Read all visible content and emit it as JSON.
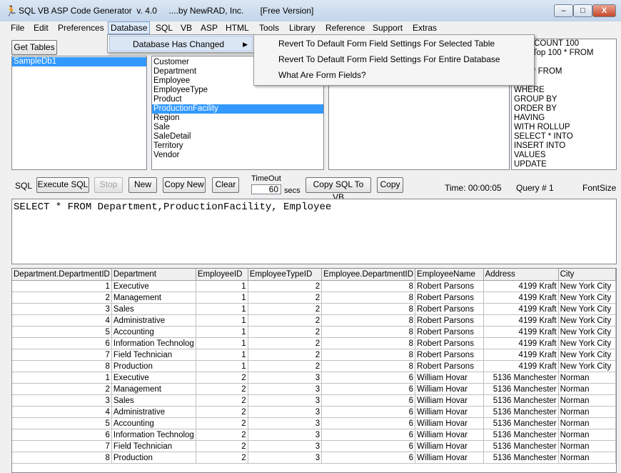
{
  "window": {
    "title": "SQL VB ASP Code Generator  v. 4.0     ....by NewRAD, Inc.       [Free Version]",
    "minimize": "–",
    "maximize": "□",
    "close": "X"
  },
  "menu": [
    "File",
    "Edit",
    "Preferences",
    "Database",
    "SQL",
    "VB",
    "ASP",
    "HTML",
    "Tools",
    "Library",
    "Reference",
    "Support",
    "Extras"
  ],
  "database_menu": {
    "item": "Database Has Changed",
    "submenu": [
      "Revert To Default Form Field Settings For Selected Table",
      "Revert To Default Form Field Settings For Entire Database",
      "What Are Form Fields?"
    ]
  },
  "get_tables": "Get Tables",
  "databases": [
    "SampleDb1"
  ],
  "tables": [
    "Customer",
    "Department",
    "Employee",
    "EmployeeType",
    "Product",
    "ProductionFacility",
    "Region",
    "Sale",
    "SaleDetail",
    "Territory",
    "Vendor"
  ],
  "keywords": [
    "ROWCOUNT 100",
    "ECT Top 100 * FROM",
    "ECT",
    "ECT * FROM",
    "",
    "WHERE",
    "GROUP BY",
    "ORDER BY",
    "HAVING",
    "WITH ROLLUP",
    "SELECT * INTO",
    "INSERT INTO",
    "VALUES",
    "UPDATE"
  ],
  "toolbar": {
    "sql_label": "SQL",
    "execute": "Execute SQL",
    "stop": "Stop",
    "new": "New",
    "copy_new": "Copy New",
    "clear": "Clear",
    "timeout_label": "TimeOut",
    "timeout_value": "60",
    "secs": "secs",
    "copy_to_vb": "Copy SQL To VB",
    "copy": "Copy",
    "time": "Time:  00:00:05",
    "query": "Query #  1",
    "fontsize": "FontSize"
  },
  "sql_text": "SELECT * FROM Department,ProductionFacility, Employee",
  "grid": {
    "columns": [
      "Department.DepartmentID",
      "Department",
      "EmployeeID",
      "EmployeeTypeID",
      "Employee.DepartmentID",
      "EmployeeName",
      "Address",
      "City"
    ],
    "rows": [
      [
        "1",
        "Executive",
        "1",
        "2",
        "8",
        "Robert Parsons",
        "4199 Kraft",
        "New York City"
      ],
      [
        "2",
        "Management",
        "1",
        "2",
        "8",
        "Robert Parsons",
        "4199 Kraft",
        "New York City"
      ],
      [
        "3",
        "Sales",
        "1",
        "2",
        "8",
        "Robert Parsons",
        "4199 Kraft",
        "New York City"
      ],
      [
        "4",
        "Administrative",
        "1",
        "2",
        "8",
        "Robert Parsons",
        "4199 Kraft",
        "New York City"
      ],
      [
        "5",
        "Accounting",
        "1",
        "2",
        "8",
        "Robert Parsons",
        "4199 Kraft",
        "New York City"
      ],
      [
        "6",
        "Information Technolog",
        "1",
        "2",
        "8",
        "Robert Parsons",
        "4199 Kraft",
        "New York City"
      ],
      [
        "7",
        "Field Technician",
        "1",
        "2",
        "8",
        "Robert Parsons",
        "4199 Kraft",
        "New York City"
      ],
      [
        "8",
        "Production",
        "1",
        "2",
        "8",
        "Robert Parsons",
        "4199 Kraft",
        "New York City"
      ],
      [
        "1",
        "Executive",
        "2",
        "3",
        "6",
        "William Hovar",
        "5136 Manchester",
        "Norman"
      ],
      [
        "2",
        "Management",
        "2",
        "3",
        "6",
        "William Hovar",
        "5136 Manchester",
        "Norman"
      ],
      [
        "3",
        "Sales",
        "2",
        "3",
        "6",
        "William Hovar",
        "5136 Manchester",
        "Norman"
      ],
      [
        "4",
        "Administrative",
        "2",
        "3",
        "6",
        "William Hovar",
        "5136 Manchester",
        "Norman"
      ],
      [
        "5",
        "Accounting",
        "2",
        "3",
        "6",
        "William Hovar",
        "5136 Manchester",
        "Norman"
      ],
      [
        "6",
        "Information Technolog",
        "2",
        "3",
        "6",
        "William Hovar",
        "5136 Manchester",
        "Norman"
      ],
      [
        "7",
        "Field Technician",
        "2",
        "3",
        "6",
        "William Hovar",
        "5136 Manchester",
        "Norman"
      ],
      [
        "8",
        "Production",
        "2",
        "3",
        "6",
        "William Hovar",
        "5136 Manchester",
        "Norman"
      ]
    ]
  }
}
